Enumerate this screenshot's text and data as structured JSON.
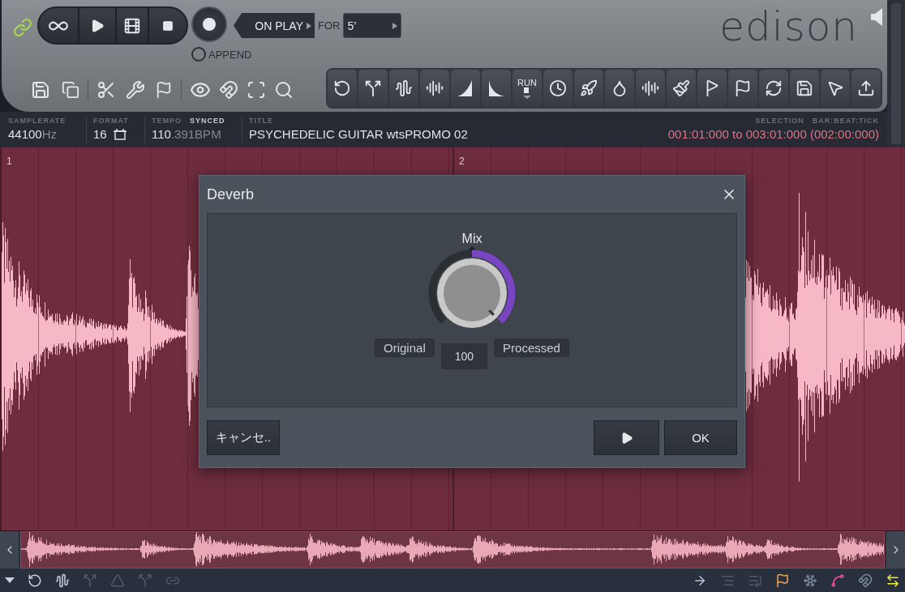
{
  "transport": {
    "on_play": "ON PLAY",
    "for_label": "FOR",
    "for_value": "5’",
    "append": {
      "label": "APPEND",
      "checked": false
    }
  },
  "logo": "edison",
  "tool_strip": {
    "run_label": "RUN"
  },
  "info_bar": {
    "samplerate": {
      "label": "SAMPLERATE",
      "value": "44100",
      "unit": "Hz"
    },
    "format": {
      "label": "FORMAT",
      "value": "16"
    },
    "tempo": {
      "label": "TEMPO",
      "synced_label": "SYNCED",
      "value": "110",
      "fraction": ".391BPM"
    },
    "title": {
      "label": "TITLE",
      "value": "PSYCHEDELIC GUITAR wtsPROMO 02"
    },
    "selection": {
      "label": "SELECTION",
      "unit_label": "BAR:BEAT:TICK",
      "value": "001:01:000 to 003:01:000 (002:00:000)"
    }
  },
  "bar_markers": [
    "1",
    "2"
  ],
  "dialog": {
    "title": "Deverb",
    "knob": {
      "label": "Mix",
      "level": 1,
      "value": "100",
      "left_label": "Original",
      "right_label": "Processed"
    },
    "cancel": "キャンセ..",
    "ok": "OK"
  },
  "bottom_tools": {
    "left": [
      {
        "disabled": false
      },
      {
        "disabled": false
      },
      {
        "disabled": false
      },
      {
        "disabled": true
      },
      {
        "disabled": true
      },
      {
        "disabled": true
      },
      {
        "disabled": true
      }
    ],
    "right": [
      {
        "disabled": false
      },
      {
        "disabled": true
      },
      {
        "disabled": true
      },
      {
        "disabled": false
      },
      {
        "disabled": false
      },
      {
        "disabled": false
      },
      {
        "disabled": false
      },
      {
        "disabled": false
      }
    ]
  }
}
